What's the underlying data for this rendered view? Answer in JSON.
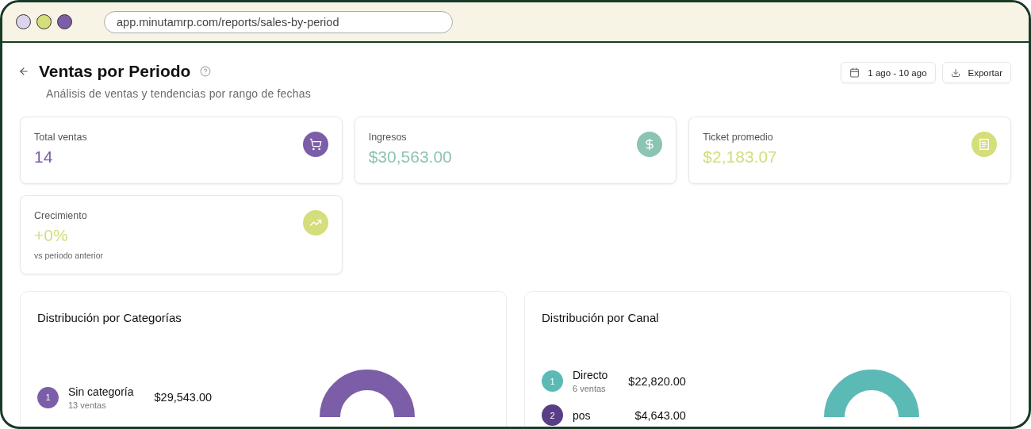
{
  "browser": {
    "url": "app.minutamrp.com/reports/sales-by-period"
  },
  "header": {
    "title": "Ventas por Periodo",
    "subtitle": "Análisis de ventas y tendencias por rango de fechas",
    "date_range": "1 ago - 10 ago",
    "export_label": "Exportar"
  },
  "stats": [
    {
      "label": "Total ventas",
      "value": "14",
      "color": "#7b5ea7"
    },
    {
      "label": "Ingresos",
      "value": "$30,563.00",
      "color": "#8cc4b4"
    },
    {
      "label": "Ticket promedio",
      "value": "$2,183.07",
      "color": "#d4de7a"
    },
    {
      "label": "Crecimiento",
      "value": "+0%",
      "color": "#d4de7a",
      "note": "vs periodo anterior"
    }
  ],
  "distributions": [
    {
      "title": "Distribución por Categorías",
      "items": [
        {
          "rank": "1",
          "name": "Sin categoría",
          "count": "13 ventas",
          "amount": "$29,543.00",
          "color": "#7b5ea7"
        }
      ]
    },
    {
      "title": "Distribución por Canal",
      "items": [
        {
          "rank": "1",
          "name": "Directo",
          "count": "6 ventas",
          "amount": "$22,820.00",
          "color": "#5bbab5"
        },
        {
          "rank": "2",
          "name": "pos",
          "amount": "$4,643.00",
          "color": "#5a3e85"
        }
      ]
    }
  ]
}
